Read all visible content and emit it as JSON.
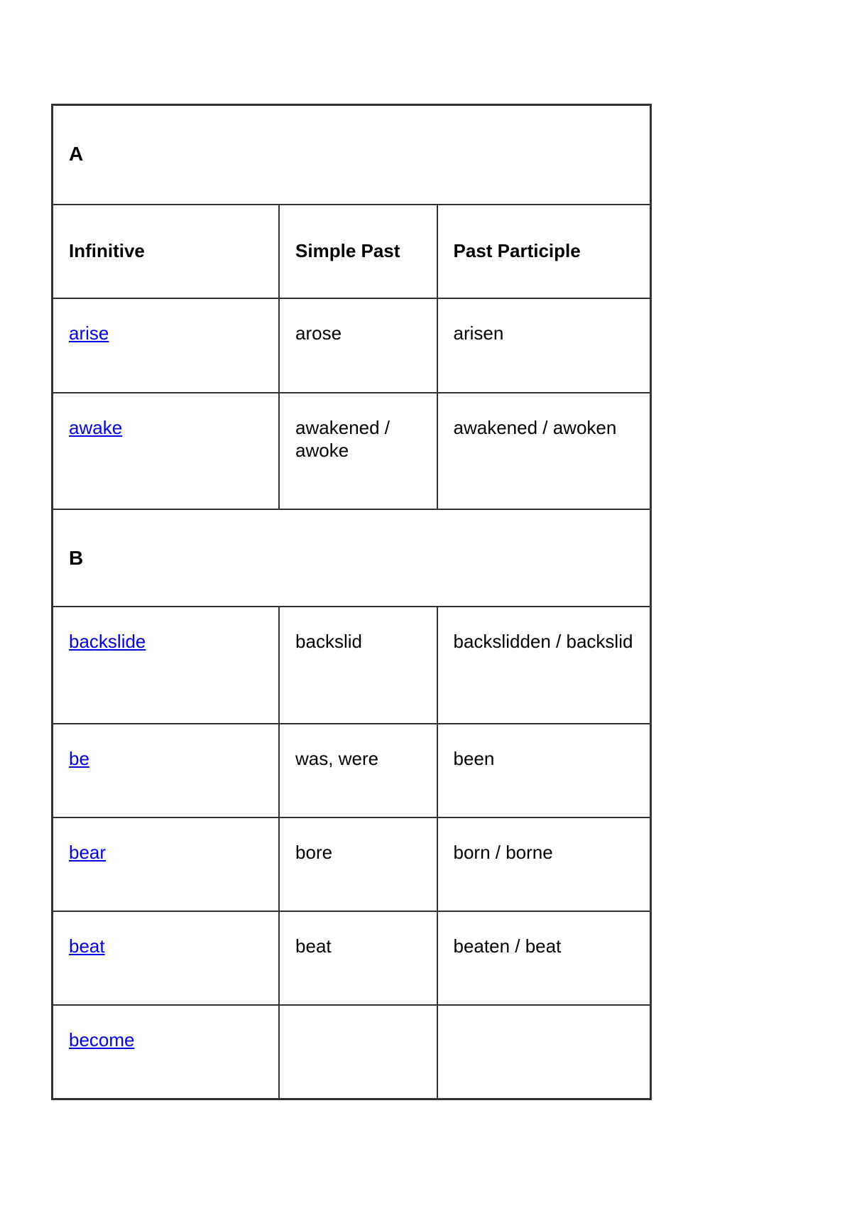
{
  "headers": [
    "Infinitive",
    "Simple Past",
    "Past Participle"
  ],
  "link_color": "#0000ee",
  "sections": [
    {
      "letter": "A",
      "rows": [
        {
          "infinitive": "arise",
          "simple_past": "arose",
          "past_participle": "arisen"
        },
        {
          "infinitive": "awake",
          "simple_past": "awakened / awoke",
          "past_participle": "awakened / awoken"
        }
      ]
    },
    {
      "letter": "B",
      "rows": [
        {
          "infinitive": "backslide",
          "simple_past": "backslid",
          "past_participle": "backslidden / backslid"
        },
        {
          "infinitive": "be",
          "simple_past": "was, were",
          "past_participle": "been"
        },
        {
          "infinitive": "bear",
          "simple_past": "bore",
          "past_participle": "born / borne"
        },
        {
          "infinitive": "beat",
          "simple_past": "beat",
          "past_participle": "beaten / beat"
        },
        {
          "infinitive": "become",
          "simple_past": "",
          "past_participle": ""
        }
      ]
    }
  ]
}
